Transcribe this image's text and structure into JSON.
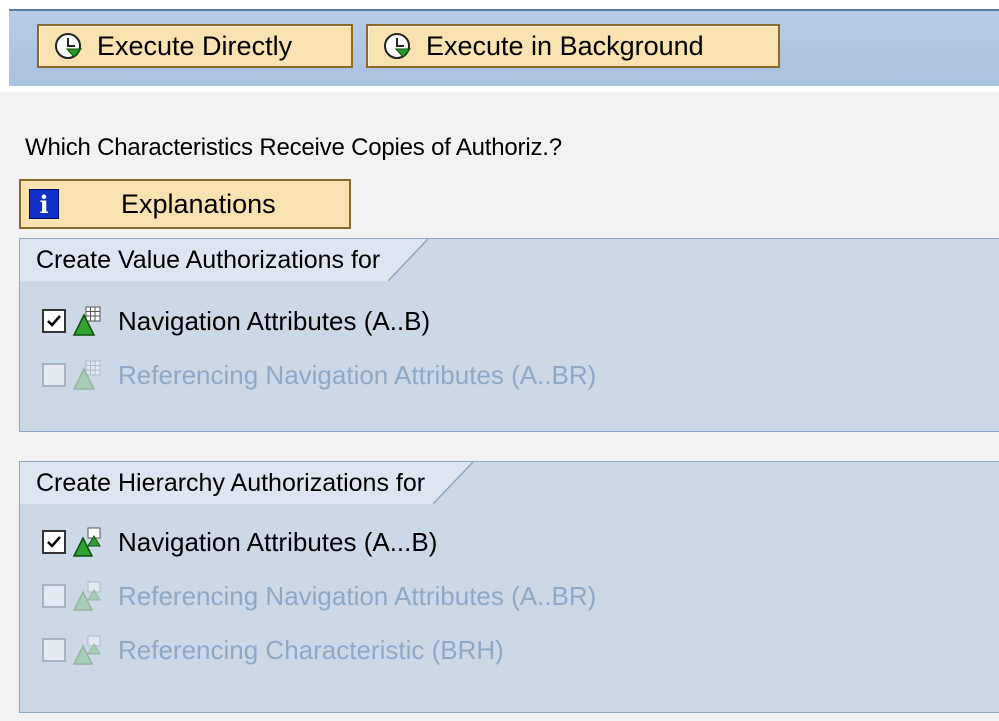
{
  "toolbar": {
    "execute_directly": "Execute Directly",
    "execute_background": "Execute in Background"
  },
  "question": "Which Characteristics Receive Copies of Authoriz.?",
  "explanations_button": "Explanations",
  "value_group": {
    "title": "Create Value Authorizations for",
    "items": [
      {
        "label": "Navigation Attributes (A..B)",
        "checked": true,
        "enabled": true
      },
      {
        "label": "Referencing Navigation Attributes (A..BR)",
        "checked": false,
        "enabled": false
      }
    ]
  },
  "hierarchy_group": {
    "title": "Create Hierarchy Authorizations for",
    "items": [
      {
        "label": "Navigation Attributes (A...B)",
        "checked": true,
        "enabled": true
      },
      {
        "label": "Referencing Navigation Attributes (A..BR)",
        "checked": false,
        "enabled": false
      },
      {
        "label": "Referencing Characteristic (BRH)",
        "checked": false,
        "enabled": false
      }
    ]
  },
  "colors": {
    "toolbar_band": "#a9c1e0",
    "button_bg": "#f7e2b0",
    "group_bg": "#ccd8e6",
    "disabled_text": "#8ea9c6"
  }
}
